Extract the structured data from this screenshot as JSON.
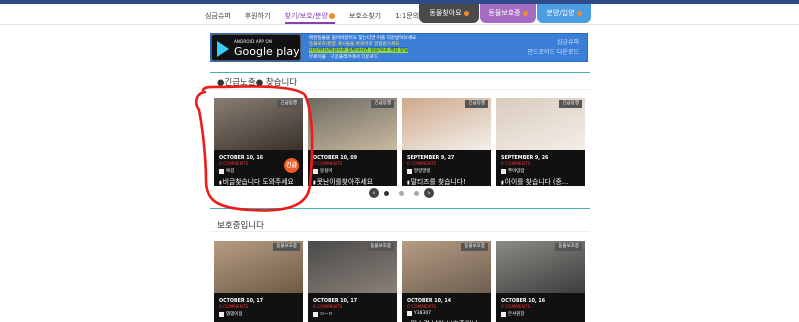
{
  "nav": {
    "items": [
      {
        "label": "심금슈퍼",
        "active": false,
        "dot": false
      },
      {
        "label": "후원하기",
        "active": false,
        "dot": false
      },
      {
        "label": "찾기/보호/분양",
        "active": true,
        "dot": true
      },
      {
        "label": "보호소찾기",
        "active": false,
        "dot": false
      },
      {
        "label": "1:1문의",
        "active": false,
        "dot": false
      }
    ],
    "tabs": [
      "동물찾아요",
      "동물보호중",
      "분양/입양"
    ]
  },
  "banner": {
    "badge_small": "ANDROID APP ON",
    "badge_big": "Google play",
    "text_lines": [
      "애완동물을 잃어버렸어요 찾는다면 어플 다운받아보세요",
      "동물보호/분양 게시물을 바로바로 알림받으세요",
      "사진/위치/특징으로 등록하시면 실종/보호 매칭 알림",
      "무료어플 · 구글플레이에서 다운로드"
    ],
    "right_lines": [
      "심금슈퍼",
      "안드로이드 다운로드"
    ]
  },
  "section1": {
    "title": "●긴급노출● 찾습니다"
  },
  "section2": {
    "title": "보호중입니다"
  },
  "urgent_cards": [
    {
      "badge": "긴급동행",
      "date": "OCTOBER 10, 16",
      "comments": "0 COMMENTS",
      "user": "복길",
      "title": "비글찾습니다 도와주세요",
      "urgent_label": "긴급",
      "color_top": "#8a7f74",
      "color_bottom": "#3a302a"
    },
    {
      "badge": "긴급동행",
      "date": "OCTOBER 10, 09",
      "comments": "0 COMMENTS",
      "user": "뭉실이",
      "title": "못난이를찾아주세요",
      "color_top": "#6e6a62",
      "color_bottom": "#c9b9a0"
    },
    {
      "badge": "긴급동행",
      "date": "SEPTEMBER 9, 27",
      "comments": "0 COMMENTS",
      "user": "말랑말랑",
      "title": "말티즈를 찾습니다!",
      "color_top": "#cfa88a",
      "color_bottom": "#f2f0ec"
    },
    {
      "badge": "긴급동행",
      "date": "SEPTEMBER 9, 26",
      "comments": "0 COMMENTS",
      "user": "쭈야맘맘",
      "title": "아이를 찾습니다 (중...",
      "color_top": "#d9cbbd",
      "color_bottom": "#f4eee8"
    }
  ],
  "protect_cards": [
    {
      "badge": "동물보호중",
      "date": "OCTOBER 10, 17",
      "comments": "0 COMMENTS",
      "user": "댕댕이용",
      "title": "",
      "color_top": "#b59d82",
      "color_bottom": "#6f5a46"
    },
    {
      "badge": "동물보호중",
      "date": "OCTOBER 10, 17",
      "comments": "0 COMMENTS",
      "user": "ㅁㅡㅁ",
      "title": "",
      "color_top": "#4a4a4a",
      "color_bottom": "#8a8077"
    },
    {
      "badge": "동물보호중",
      "date": "OCTOBER 10, 14",
      "comments": "0 COMMENTS",
      "user": "Y38307",
      "title": "믹스견 남아 보호중입니",
      "color_top": "#b69c84",
      "color_bottom": "#6e5f50"
    },
    {
      "badge": "동물보호중",
      "date": "OCTOBER 10, 16",
      "comments": "0 COMMENTS",
      "user": "은서원장",
      "title": "",
      "color_top": "#8c8a86",
      "color_bottom": "#3e3d3c"
    }
  ],
  "carousel": {
    "prev": "‹",
    "next": "›",
    "pages": 3,
    "active_page": 1
  }
}
